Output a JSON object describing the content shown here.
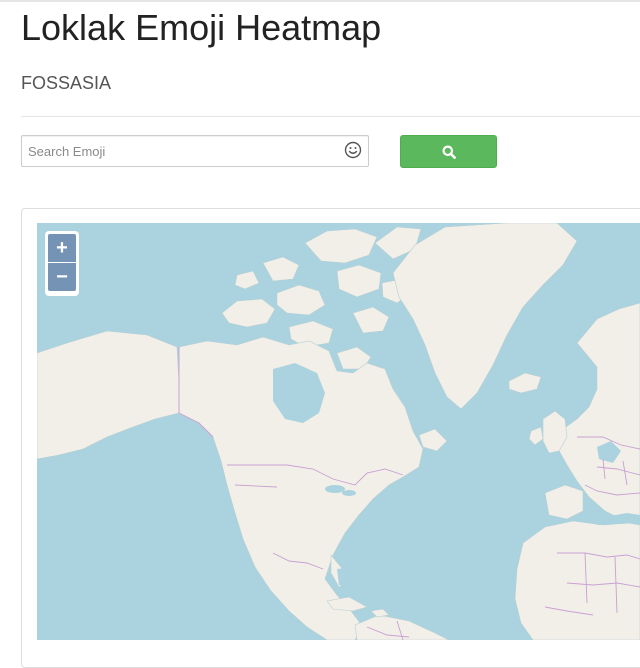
{
  "header": {
    "title": "Loklak Emoji Heatmap",
    "org": "FOSSASIA"
  },
  "search": {
    "placeholder": "Search Emoji",
    "value": "",
    "emoji_icon": "smiley-icon",
    "button_icon": "search-icon",
    "button_color": "#5cb85c"
  },
  "map": {
    "zoom_in_label": "+",
    "zoom_out_label": "−",
    "ocean_color": "#aad3df",
    "land_color": "#f2efe9",
    "border_color": "#c9a0d2",
    "controls_color": "#7594b5"
  }
}
